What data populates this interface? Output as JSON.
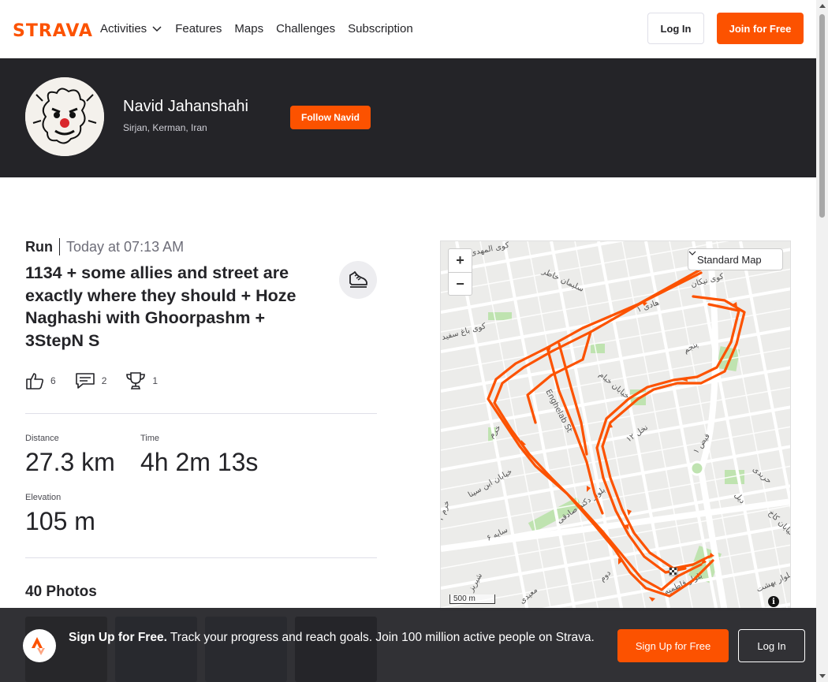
{
  "brand": {
    "logo_text": "STRAVA",
    "accent_color": "#fc5200",
    "dark_color": "#242428"
  },
  "nav": {
    "items": [
      {
        "label": "Activities",
        "has_dropdown": true
      },
      {
        "label": "Features"
      },
      {
        "label": "Maps"
      },
      {
        "label": "Challenges"
      },
      {
        "label": "Subscription"
      }
    ],
    "login_label": "Log In",
    "join_label": "Join for Free"
  },
  "athlete": {
    "name": "Navid Jahanshahi",
    "location": "Sirjan, Kerman, Iran",
    "follow_label": "Follow Navid"
  },
  "activity": {
    "type": "Run",
    "time": "Today at 07:13 AM",
    "title": "1134 + some allies and street are exactly where they should + Hoze Naghashi with Ghoorpashm + 3StepN S",
    "kudos_count": "6",
    "comments_count": "2",
    "achievements_count": "1",
    "stats": {
      "distance_label": "Distance",
      "distance_value": "27.3 km",
      "time_label": "Time",
      "time_value": "4h 2m 13s",
      "elevation_label": "Elevation",
      "elevation_value": "105 m"
    },
    "photos_title": "40 Photos"
  },
  "map": {
    "type_selected": "Standard Map",
    "zoom_in": "+",
    "zoom_out": "−",
    "scale": "500 m",
    "info": "i",
    "route_color": "#fc5200",
    "street_labels": [
      "کوی المهدی",
      "سلیمان خاطر",
      "هادی ۱",
      "کوی نیکان",
      "کوی باغ سفید",
      "پنجم",
      "Enghelab St",
      "خیابان خیام",
      "نخل ۱۲",
      "فیض ۱",
      "خرم",
      "حریدی",
      "خیابان ابن سینا",
      "بلوار دکتر صادقی",
      "دیل",
      "خیابان کاخ",
      "سایه ۶",
      "بلوار فاطمیه",
      "بلوار بهشت",
      "دوم",
      "معیدی",
      "خرم ۲",
      "شیریز"
    ]
  },
  "banner": {
    "headline": "Sign Up for Free.",
    "text": "Track your progress and reach goals. Join 100 million active people on Strava.",
    "signup_label": "Sign Up for Free",
    "login_label": "Log In"
  }
}
